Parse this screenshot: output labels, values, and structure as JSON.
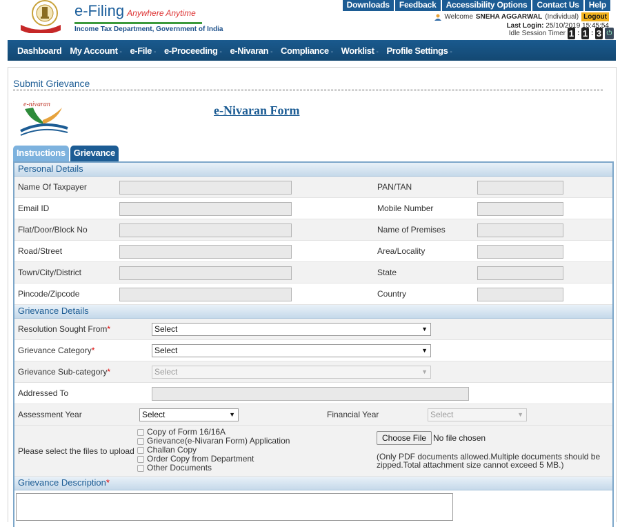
{
  "header": {
    "brand_title": "e-Filing",
    "brand_tagline": "Anywhere Anytime",
    "brand_subtitle": "Income Tax Department, Government of India",
    "top_links": [
      "Downloads",
      "Feedback",
      "Accessibility Options",
      "Contact Us",
      "Help"
    ],
    "welcome_prefix": "Welcome",
    "user_name": "SNEHA AGGARWAL",
    "user_type": "(Individual)",
    "logout_label": "Logout",
    "last_login_label": "Last Login:",
    "last_login_value": "25/10/2019 15:45:54",
    "idle_label": "Idle Session Timer",
    "timer_digits": [
      "1",
      "1",
      "3"
    ]
  },
  "nav": {
    "items": [
      {
        "label": "Dashboard",
        "has_menu": false
      },
      {
        "label": "My Account",
        "has_menu": true
      },
      {
        "label": "e-File",
        "has_menu": true
      },
      {
        "label": "e-Proceeding",
        "has_menu": true
      },
      {
        "label": "e-Nivaran",
        "has_menu": true
      },
      {
        "label": "Compliance",
        "has_menu": true
      },
      {
        "label": "Worklist",
        "has_menu": true
      },
      {
        "label": "Profile Settings",
        "has_menu": true
      }
    ],
    "caret": "-"
  },
  "page": {
    "title": "Submit Grievance",
    "logo_text": "e-nivaran",
    "form_heading": "e-Nivaran Form"
  },
  "tabs": [
    "Instructions",
    "Grievance"
  ],
  "personal": {
    "heading": "Personal Details",
    "rows": [
      {
        "left": "Name Of Taxpayer",
        "right": "PAN/TAN"
      },
      {
        "left": "Email ID",
        "right": "Mobile Number"
      },
      {
        "left": "Flat/Door/Block No",
        "right": "Name of Premises"
      },
      {
        "left": "Road/Street",
        "right": "Area/Locality"
      },
      {
        "left": "Town/City/District",
        "right": "State"
      },
      {
        "left": "Pincode/Zipcode",
        "right": "Country"
      }
    ]
  },
  "grievance": {
    "heading": "Grievance Details",
    "resolution_label": "Resolution Sought From",
    "resolution_value": "Select",
    "category_label": "Grievance Category",
    "category_value": "Select",
    "subcategory_label": "Grievance Sub-category",
    "subcategory_value": "Select",
    "addressed_label": "Addressed To",
    "ay_label": "Assessment Year",
    "ay_value": "Select",
    "fy_label": "Financial Year",
    "fy_value": "Select",
    "files_label": "Please select the files to upload",
    "file_options": [
      "Copy of Form 16/16A",
      "Grievance(e-Nivaran Form) Application",
      "Challan Copy",
      "Order Copy from Department",
      "Other Documents"
    ],
    "choose_file_label": "Choose File",
    "no_file_text": "No file chosen",
    "file_note": "(Only PDF documents allowed.Multiple documents should be zipped.Total attachment size cannot exceed 5 MB.)"
  },
  "description": {
    "heading": "Grievance Description"
  },
  "colors": {
    "primary": "#1c5c94",
    "tab_inactive": "#7db2de",
    "logout_bg": "#f2b21c",
    "required": "#dd0000"
  }
}
